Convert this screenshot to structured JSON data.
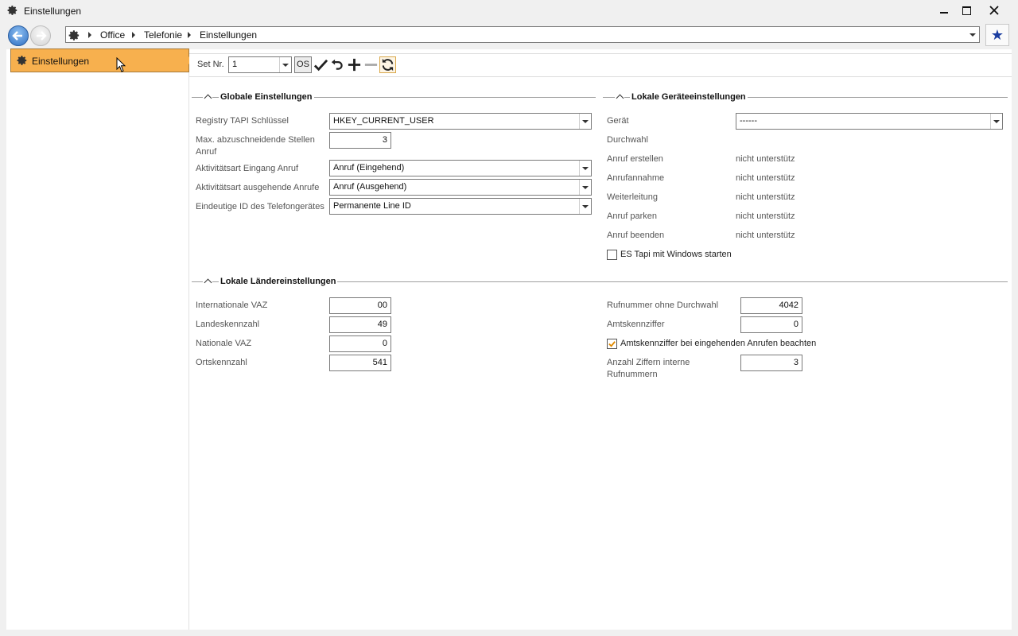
{
  "window": {
    "title": "Einstellungen",
    "minimize_icon": "minimize-icon",
    "maximize_icon": "maximize-icon",
    "close_icon": "close-icon"
  },
  "navigation": {
    "back_icon": "back-arrow-icon",
    "forward_icon": "forward-arrow-icon",
    "breadcrumb": [
      "Office",
      "Telefonie",
      "Einstellungen"
    ],
    "favorite_icon": "star-icon"
  },
  "sidebar": {
    "items": [
      {
        "label": "Einstellungen",
        "icon": "gear-icon",
        "selected": true
      }
    ]
  },
  "toolbar": {
    "set_label": "Set Nr.",
    "set_value": "1",
    "os_label": "OS",
    "icons": [
      "check-icon",
      "undo-icon",
      "plus-icon",
      "minus-icon",
      "refresh-icon"
    ]
  },
  "global": {
    "title": "Globale Einstellungen",
    "rows": [
      {
        "label": "Registry TAPI Schlüssel",
        "value": "HKEY_CURRENT_USER"
      },
      {
        "label": "Max. abzuschneidende Stellen",
        "label2": "Anruf",
        "value": "3"
      },
      {
        "label": "Aktivitätsart Eingang Anruf",
        "value": "Anruf (Eingehend)"
      },
      {
        "label": "Aktivitätsart ausgehende Anrufe",
        "value": "Anruf (Ausgehend)"
      },
      {
        "label": "Eindeutige ID des Telefongerätes",
        "value": "Permanente Line ID"
      }
    ]
  },
  "device": {
    "title": "Lokale Geräteeinstellungen",
    "geraet_label": "Gerät",
    "geraet_value": "------",
    "durchwahl_label": "Durchwahl",
    "features": [
      {
        "label": "Anruf erstellen",
        "value": "nicht unterstütz"
      },
      {
        "label": "Anrufannahme",
        "value": "nicht unterstütz"
      },
      {
        "label": "Weiterleitung",
        "value": "nicht unterstütz"
      },
      {
        "label": "Anruf parken",
        "value": "nicht unterstütz"
      },
      {
        "label": "Anruf beenden",
        "value": "nicht unterstütz"
      }
    ],
    "autostart_label": "ES Tapi mit Windows starten",
    "autostart_checked": false
  },
  "country": {
    "title": "Lokale Ländereinstellungen",
    "left": [
      {
        "label": "Internationale VAZ",
        "value": "00"
      },
      {
        "label": "Landeskennzahl",
        "value": "49"
      },
      {
        "label": "Nationale VAZ",
        "value": "0"
      },
      {
        "label": "Ortskennzahl",
        "value": "541"
      }
    ],
    "rufnummer_label": "Rufnummer ohne Durchwahl",
    "rufnummer_value": "4042",
    "amt_label": "Amtskennziffer",
    "amt_value": "0",
    "amt_check_label": "Amtskennziffer bei eingehenden Anrufen beachten",
    "amt_checked": true,
    "ziffern_label": "Anzahl Ziffern interne",
    "ziffern_label2": "Rufnummern",
    "ziffern_value": "3"
  },
  "colors": {
    "selection": "#f7b04e",
    "accent": "#2e6fc2"
  }
}
